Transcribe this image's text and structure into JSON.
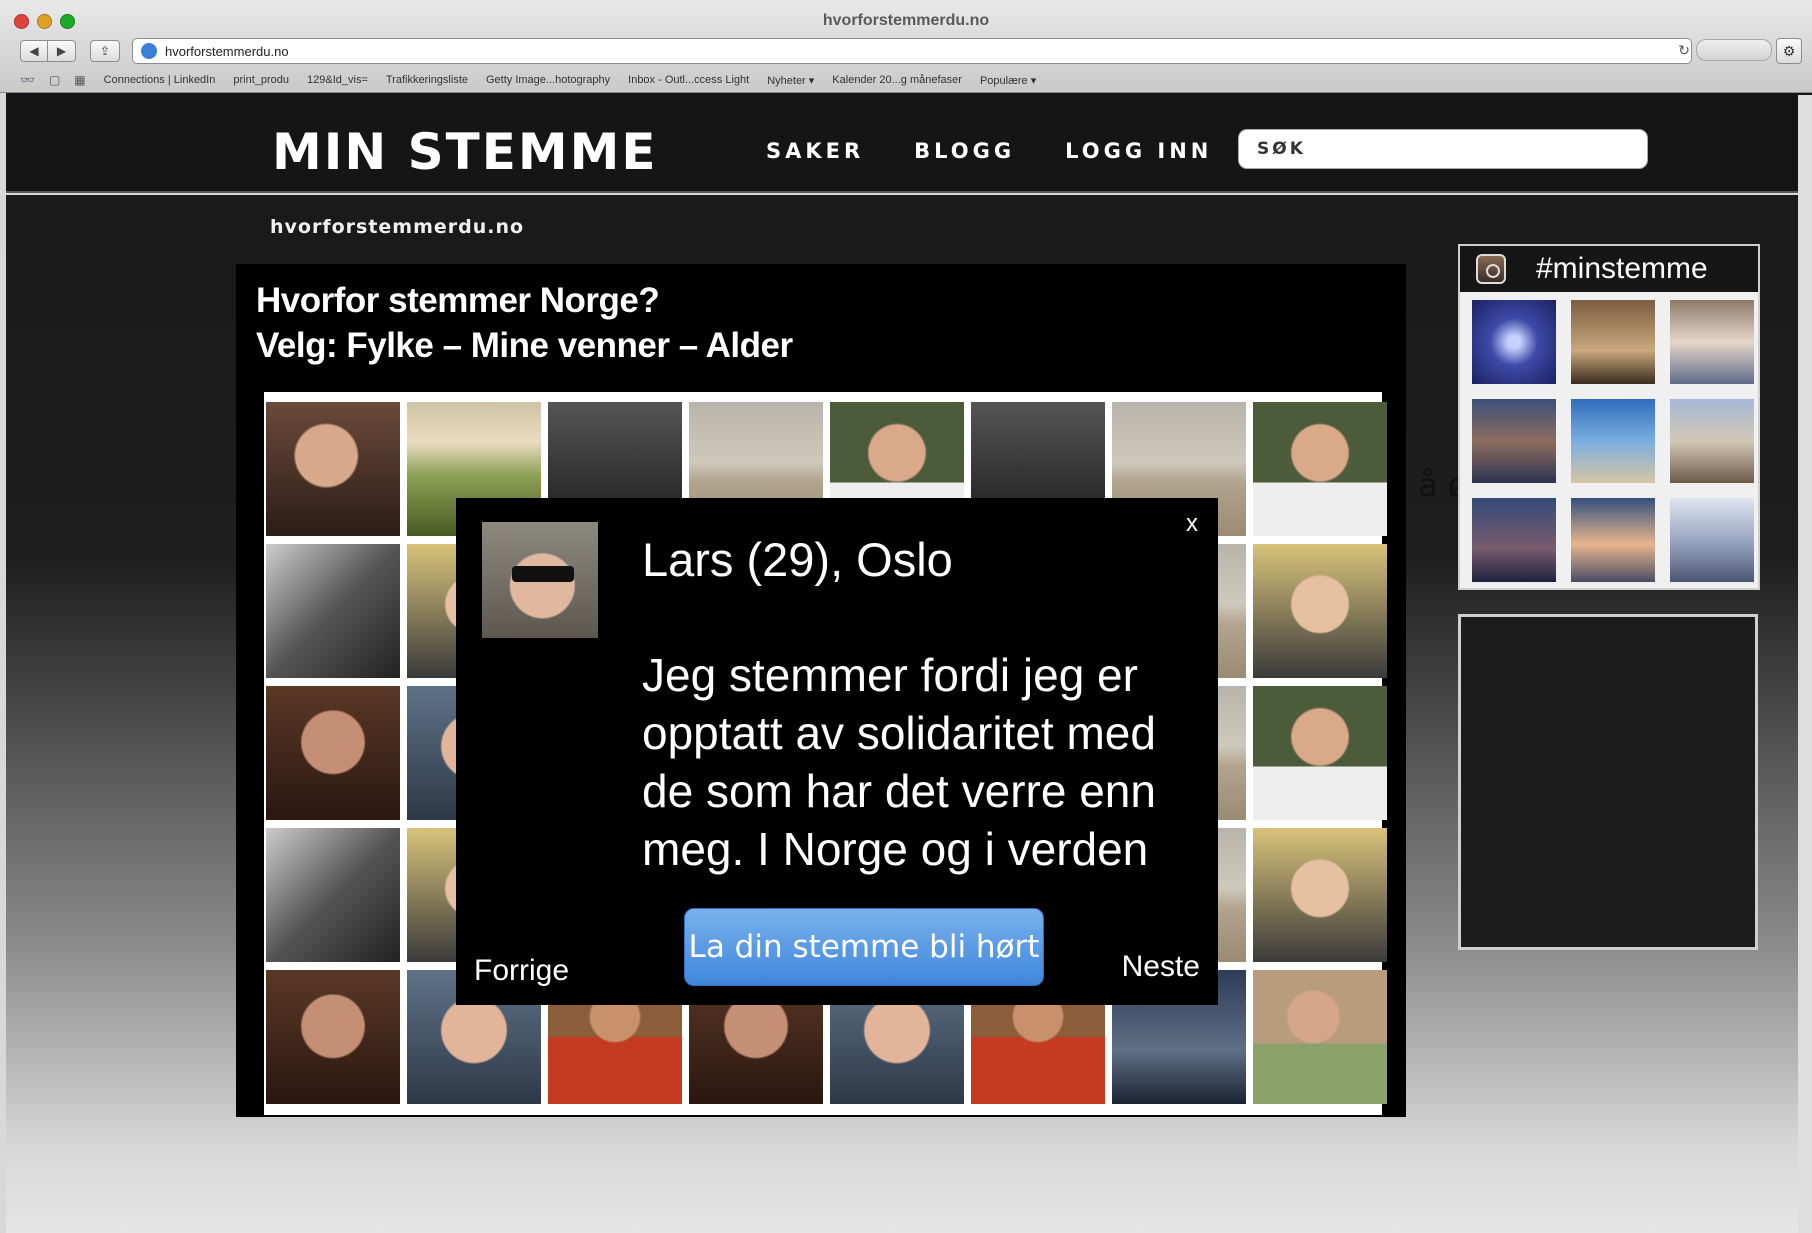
{
  "browser": {
    "window_title": "hvorforstemmerdu.no",
    "url": "hvorforstemmerdu.no",
    "bookmarks": [
      "Connections | LinkedIn",
      "print_produ",
      "129&Id_vis=",
      "Trafikkeringsliste",
      "Getty Image...hotography",
      "Inbox - Outl...ccess Light",
      "Nyheter ▾",
      "Kalender 20...g månefaser",
      "Populære ▾"
    ],
    "traffic_colors": [
      "#e0443e",
      "#dea123",
      "#1aab29"
    ]
  },
  "header": {
    "logo": "MIN STEMME",
    "nav": [
      "SAKER",
      "BLOGG",
      "LOGG INN"
    ],
    "search_placeholder": "SØK"
  },
  "domain_label": "hvorforstemmerdu.no",
  "main": {
    "headline_line1": "Hvorfor stemmer Norge?",
    "headline_line2": "Velg: Fylke – Mine venner – Alder"
  },
  "modal": {
    "close": "x",
    "who": "Lars (29), Oslo",
    "quote": "Jeg stemmer fordi jeg er opptatt av solidaritet med de som har det verre enn meg. I Norge og i verden",
    "cta": "La din stemme bli hørt",
    "prev": "Forrige",
    "next": "Neste",
    "cta_color": "#4a8fe0"
  },
  "sidebar": {
    "instagram_tag": "#minstemme"
  },
  "stray_text": "å øke"
}
